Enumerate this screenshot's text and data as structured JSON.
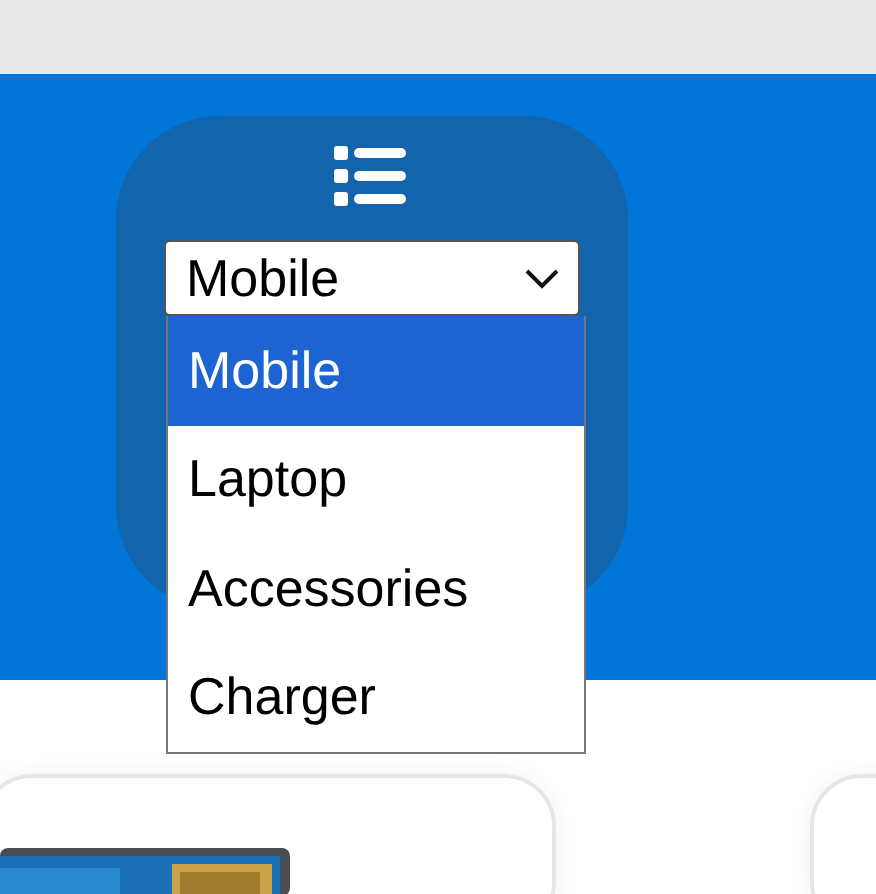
{
  "category_select": {
    "value": "Mobile"
  },
  "category_options": [
    {
      "label": "Mobile",
      "selected": true
    },
    {
      "label": "Laptop",
      "selected": false
    },
    {
      "label": "Accessories",
      "selected": false
    },
    {
      "label": "Charger",
      "selected": false
    }
  ],
  "product_cards": [
    {
      "kind": "picture"
    },
    {
      "kind": "empty"
    }
  ]
}
